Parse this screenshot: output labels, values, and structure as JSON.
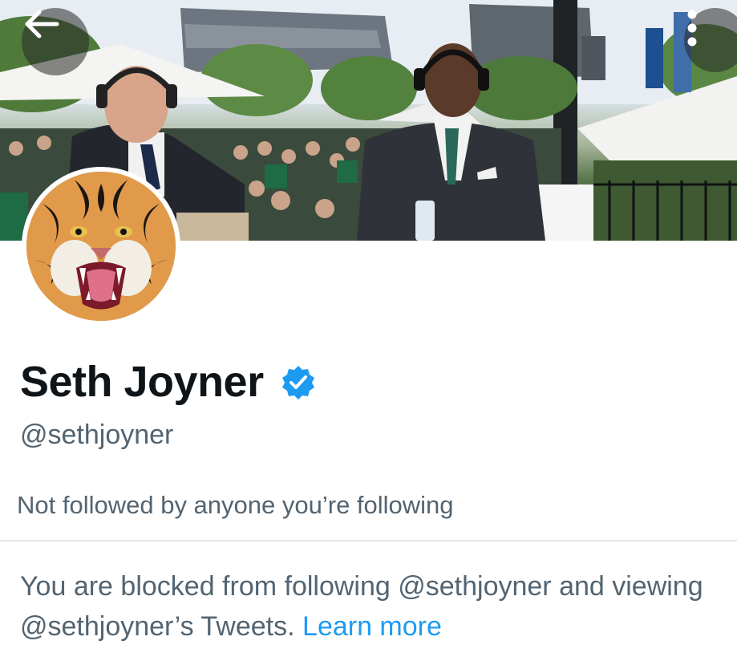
{
  "header": {
    "back_icon": "arrow-left-icon",
    "more_icon": "more-vertical-icon",
    "banner_image": "broadcast-booth-stadium-photo"
  },
  "profile": {
    "avatar": "tiger-avatar",
    "name": "Seth Joyner",
    "verified_icon": "verified-badge-icon",
    "verified_color": "#1d9bf0",
    "handle": "@sethjoyner",
    "followed_by": "Not followed by anyone you’re following"
  },
  "blocked_notice": {
    "text": "You are blocked from following @sethjoyner and viewing @sethjoyner’s Tweets.",
    "link_label": "Learn more",
    "link_color": "#1d9bf0"
  }
}
